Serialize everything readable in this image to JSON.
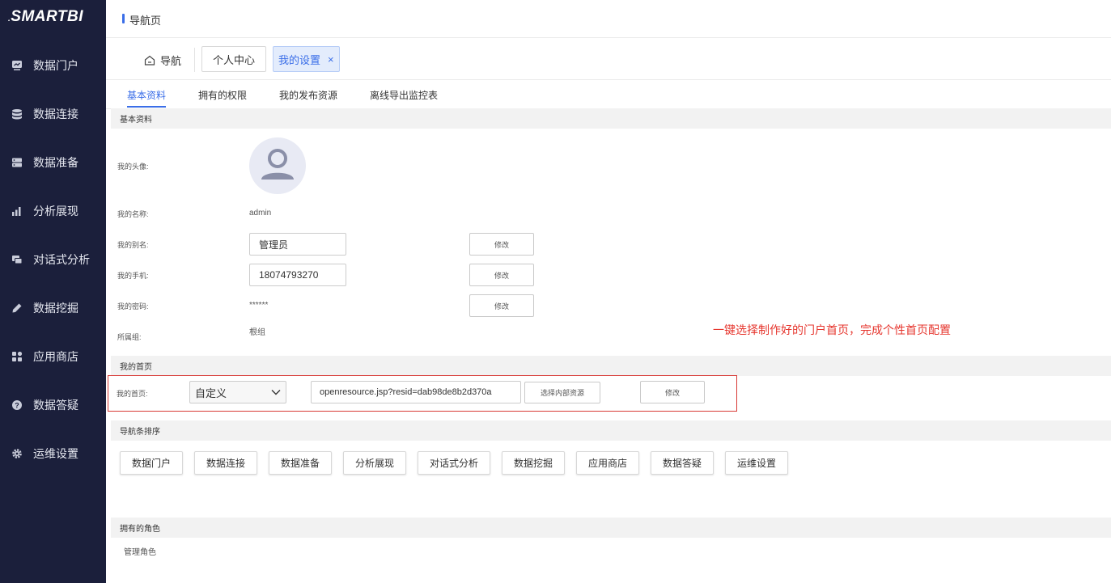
{
  "app": {
    "logo": "SMARTBI"
  },
  "sidebar": {
    "items": [
      {
        "label": "数据门户",
        "icon": "portal-icon"
      },
      {
        "label": "数据连接",
        "icon": "database-icon"
      },
      {
        "label": "数据准备",
        "icon": "server-icon"
      },
      {
        "label": "分析展现",
        "icon": "bar-chart-icon"
      },
      {
        "label": "对话式分析",
        "icon": "chat-icon"
      },
      {
        "label": "数据挖掘",
        "icon": "pen-icon"
      },
      {
        "label": "应用商店",
        "icon": "apps-icon"
      },
      {
        "label": "数据答疑",
        "icon": "question-icon"
      },
      {
        "label": "运维设置",
        "icon": "gear-icon"
      }
    ]
  },
  "header": {
    "title": "导航页"
  },
  "page_tabs": {
    "home": "导航",
    "tabs": [
      {
        "label": "个人中心",
        "active": false
      },
      {
        "label": "我的设置",
        "active": true
      }
    ],
    "close_glyph": "×"
  },
  "sub_tabs": [
    "基本资料",
    "拥有的权限",
    "我的发布资源",
    "离线导出监控表"
  ],
  "basic": {
    "section_title": "基本资料",
    "avatar_label": "我的头像:",
    "name_label": "我的名称:",
    "name_value": "admin",
    "alias_label": "我的别名:",
    "alias_value": "管理员",
    "phone_label": "我的手机:",
    "phone_value": "18074793270",
    "password_label": "我的密码:",
    "password_value": "******",
    "group_label": "所属组:",
    "group_value": "根组",
    "modify_label": "修改"
  },
  "annotation": "一键选择制作好的门户首页，完成个性首页配置",
  "homepage": {
    "section_title": "我的首页",
    "label": "我的首页:",
    "select_value": "自定义",
    "url_value": "openresource.jsp?resid=dab98de8b2d370a",
    "choose_label": "选择内部资源",
    "modify_label": "修改"
  },
  "nav_order": {
    "section_title": "导航条排序",
    "items": [
      "数据门户",
      "数据连接",
      "数据准备",
      "分析展现",
      "对话式分析",
      "数据挖掘",
      "应用商店",
      "数据答疑",
      "运维设置"
    ]
  },
  "roles": {
    "section_title": "拥有的角色",
    "items": [
      "管理角色"
    ]
  },
  "colors": {
    "sidebar_bg": "#1b1f3b",
    "accent": "#3a6ee8",
    "annotation": "#e6362e"
  }
}
